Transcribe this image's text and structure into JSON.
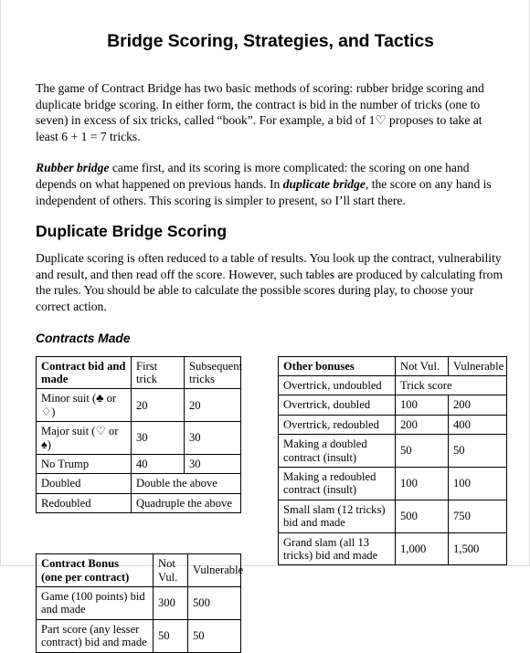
{
  "document": {
    "title": "Bridge Scoring, Strategies, and Tactics",
    "paragraph_1": "The game of Contract Bridge has two basic methods of scoring:  rubber bridge scoring and duplicate bridge scoring.  In either form, the contract is bid in the number of tricks (one to seven) in excess of six tricks, called “book”.  For example, a bid of 1♡ proposes to take at least 6 + 1 = 7 tricks.",
    "paragraph_2": {
      "emphasis_1": "Rubber bridge",
      "text_1": " came first, and its scoring is more complicated:  the scoring on one hand depends on what happened on previous hands.  In ",
      "emphasis_2": "duplicate bridge",
      "text_2": ", the score on any hand is independent of others.  This scoring is simpler to present, so I’ll start there."
    },
    "section_heading": "Duplicate Bridge Scoring",
    "paragraph_3": "Duplicate scoring is often reduced to a table of results.  You look up the contract, vulnerability and result, and then read off the score.  However, such tables are produced by calculating from the rules.  You should be able to calculate the possible scores during play, to choose your correct action.",
    "sub_heading": "Contracts Made"
  },
  "table_contracts_made": {
    "headers": [
      "Contract bid and made",
      "First trick",
      "Subsequent tricks"
    ],
    "rows": [
      {
        "label": "Minor suit (♣ or ♢)",
        "first": "20",
        "subsequent": "20",
        "merged": false
      },
      {
        "label": "Major suit (♡ or ♠)",
        "first": "30",
        "subsequent": "30",
        "merged": false
      },
      {
        "label": "No Trump",
        "first": "40",
        "subsequent": "30",
        "merged": false
      },
      {
        "label": "Doubled",
        "merged": true,
        "merged_text": "Double the above"
      },
      {
        "label": "Redoubled",
        "merged": true,
        "merged_text": "Quadruple the above"
      }
    ]
  },
  "table_contract_bonus": {
    "headers": [
      "Contract Bonus (one per contract)",
      "Not Vul.",
      "Vulnerable"
    ],
    "header_line1": "Contract Bonus",
    "header_line2": "(one per contract)",
    "rows": [
      {
        "label": "Game (100 points) bid and made",
        "not_vul": "300",
        "vulnerable": "500"
      },
      {
        "label": "Part score (any lesser contract) bid and made",
        "not_vul": "50",
        "vulnerable": "50"
      }
    ]
  },
  "table_other_bonuses": {
    "headers": [
      "Other bonuses",
      "Not Vul.",
      "Vulnerable"
    ],
    "rows": [
      {
        "label": "Overtrick, undoubled",
        "merged": true,
        "merged_text": "Trick score"
      },
      {
        "label": "Overtrick, doubled",
        "merged": false,
        "not_vul": "100",
        "vulnerable": "200"
      },
      {
        "label": "Overtrick, redoubled",
        "merged": false,
        "not_vul": "200",
        "vulnerable": "400"
      },
      {
        "label": "Making a doubled contract (insult)",
        "merged": false,
        "not_vul": "50",
        "vulnerable": "50"
      },
      {
        "label": "Making a redoubled contract (insult)",
        "merged": false,
        "not_vul": "100",
        "vulnerable": "100"
      },
      {
        "label": "Small slam (12 tricks) bid and made",
        "merged": false,
        "not_vul": "500",
        "vulnerable": "750"
      },
      {
        "label": "Grand slam (all 13 tricks) bid and made",
        "merged": false,
        "not_vul": "1,000",
        "vulnerable": "1,500"
      }
    ]
  },
  "colors": {
    "text": "#000000",
    "page_background": "#ffffff",
    "table_border": "#000000",
    "page_border": "#dcdcdc"
  }
}
